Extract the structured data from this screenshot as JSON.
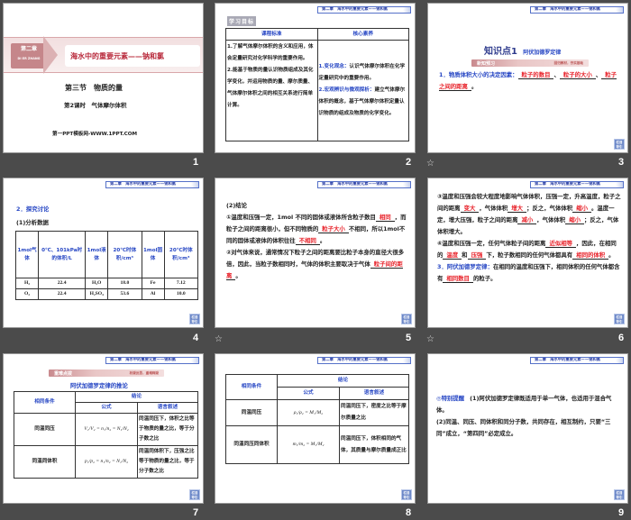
{
  "slide_numbers": [
    "1",
    "2",
    "3",
    "4",
    "5",
    "6",
    "7",
    "8",
    "9"
  ],
  "transition_icon": "star-transition-icon",
  "header_banner": "第二章　海水中的重要元素——钠和氯",
  "nav_button": "栏目导引",
  "slide1": {
    "chapter": "第二章",
    "chapter_pinyin": "DI ER ZHANG",
    "chapter_title": "海水中的重要元素——钠和氯",
    "section": "第三节　物质的量",
    "lesson": "第2课时　气体摩尔体积",
    "footer": "第一PPT模板网-WWW.1PPT.COM"
  },
  "slide2": {
    "badge": "学习目标",
    "headers": [
      "课程标准",
      "核心素养"
    ],
    "left": "1.了解气体摩尔体积的含义和应用，体会定量研究对化学科学的重要作用。\n2.能基于物质的量认识物质组成及其化学变化，并运用物质的量、摩尔质量、气体摩尔体积之间的相互关系进行简单计算。",
    "right": [
      {
        "k": "1.变化观念：",
        "v": "认识气体摩尔体积在化学定量研究中的重要作用。"
      },
      {
        "k": "2.宏观辨识与微观探析：",
        "v": "建立气体摩尔体积的概念，基于气体摩尔体积定量认识物质的组成及物质的化学变化。"
      }
    ]
  },
  "slide3": {
    "kp": "知识点1",
    "kp_title": "阿伏加德罗定律",
    "bar": "新知预习",
    "bar_note": "回归教材，夯实基础",
    "para": [
      {
        "t": "1．物质体积大小的决定因素：",
        "c": "blue"
      },
      {
        "t": "粒子的数目",
        "c": "blank"
      },
      {
        "t": "、",
        "c": ""
      },
      {
        "t": "粒子的大小",
        "c": "blank"
      },
      {
        "t": "、",
        "c": ""
      },
      {
        "t": "粒子之间的距离",
        "c": "blank"
      },
      {
        "t": "。",
        "c": ""
      }
    ]
  },
  "slide4": {
    "heading": "2．探究讨论",
    "sub": "(1)分析数据",
    "headers": [
      "1mol气体",
      "0℃、101kPa时的体积/L",
      "1mol液体",
      "20℃时体积/cm³",
      "1mol固体",
      "20℃时体积/cm³"
    ],
    "rows": [
      [
        "H₂",
        "22.4",
        "H₂O",
        "18.0",
        "Fe",
        "7.12"
      ],
      [
        "O₂",
        "22.4",
        "H₂SO₄",
        "53.6",
        "Al",
        "10.0"
      ]
    ]
  },
  "slide5": {
    "para": [
      {
        "t": "(2)结论",
        "c": "br"
      },
      {
        "t": "①温度和压强一定，1mol 不同的固体或液体所含粒子数目",
        "c": ""
      },
      {
        "t": "相同",
        "c": "blank"
      },
      {
        "t": "，而粒子之间的距离很小，但不同物质的",
        "c": ""
      },
      {
        "t": "粒子大小",
        "c": "blank"
      },
      {
        "t": "不相同，所以1mol不同的固体或液体的体积往往",
        "c": ""
      },
      {
        "t": "不相同",
        "c": "blank"
      },
      {
        "t": "。",
        "c": "br"
      },
      {
        "t": "②对气体来说，通常情况下粒子之间的距离要比粒子本身的直径大很多倍，因此，当粒子数相同时，气体的体积主要取决于气体",
        "c": ""
      },
      {
        "t": "粒子间的距离",
        "c": "blank"
      },
      {
        "t": "。",
        "c": ""
      }
    ]
  },
  "slide6": {
    "para": [
      {
        "t": "③温度和压强会较大程度地影响气体体积，压强一定，升高温度，粒子之间的距离",
        "c": ""
      },
      {
        "t": "变大",
        "c": "blank"
      },
      {
        "t": "，气体体积",
        "c": ""
      },
      {
        "t": "增大",
        "c": "blank"
      },
      {
        "t": "；反之，气体体积",
        "c": ""
      },
      {
        "t": "缩小",
        "c": "blank"
      },
      {
        "t": "。温度一定，增大压强，粒子之间的距离",
        "c": ""
      },
      {
        "t": "减小",
        "c": "blank"
      },
      {
        "t": "，气体体积",
        "c": ""
      },
      {
        "t": "缩小",
        "c": "blank"
      },
      {
        "t": "；反之，气体体积增大。",
        "c": "br"
      },
      {
        "t": "④温度和压强一定，任何气体粒子间的距离",
        "c": ""
      },
      {
        "t": "近似相等",
        "c": "blank"
      },
      {
        "t": "，因此，在相同的",
        "c": ""
      },
      {
        "t": "温度",
        "c": "blank"
      },
      {
        "t": "和",
        "c": ""
      },
      {
        "t": "压强",
        "c": "blank"
      },
      {
        "t": "下，粒子数相同的任何气体都具有",
        "c": ""
      },
      {
        "t": "相同的体积",
        "c": "blank"
      },
      {
        "t": "。",
        "c": "br"
      },
      {
        "t": "3．阿伏加德罗定律：",
        "c": "blue"
      },
      {
        "t": "在相同的温度和压强下，相同体积的任何气体都含有",
        "c": ""
      },
      {
        "t": "相同数目",
        "c": "blank"
      },
      {
        "t": "的粒子。",
        "c": ""
      }
    ]
  },
  "slide7": {
    "bar": "重难点拨",
    "bar_note": "析疑反思，重难释疑",
    "title": "阿伏加德罗定律的推论",
    "h_cond": "相同条件",
    "h_concl": "结论",
    "h_formula": "公式",
    "h_text": "语言叙述",
    "rows": [
      {
        "cond": "同温同压",
        "formula": "V₁/V₂ = n₁/n₂ = N₁/N₂",
        "text": "同温同压下，体积之比等于物质的量之比，等于分子数之比"
      },
      {
        "cond": "同温同体积",
        "formula": "p₁/p₂ = n₁/n₂ = N₁/N₂",
        "text": "同温同体积下，压强之比等于物质的量之比，等于分子数之比"
      }
    ]
  },
  "slide8": {
    "h_cond": "相同条件",
    "h_concl": "结论",
    "h_formula": "公式",
    "h_text": "语言叙述",
    "rows": [
      {
        "cond": "同温同压",
        "formula": "ρ₁/ρ₂ = M₁/M₂",
        "text": "同温同压下，密度之比等于摩尔质量之比"
      },
      {
        "cond": "同温同压同体积",
        "formula": "m₁/m₂ = M₁/M₂",
        "text": "同温同压下，体积相同的气体，其质量与摩尔质量成正比"
      }
    ]
  },
  "slide9": {
    "tip": "◎特别提醒",
    "p1": "(1)阿伏加德罗定律既适用于单一气体，也适用于混合气体。",
    "p2": "(2)同温、同压、同体积和同分子数，共同存在，相互制约，只要“三同”成立，“第四同”必定成立。"
  }
}
